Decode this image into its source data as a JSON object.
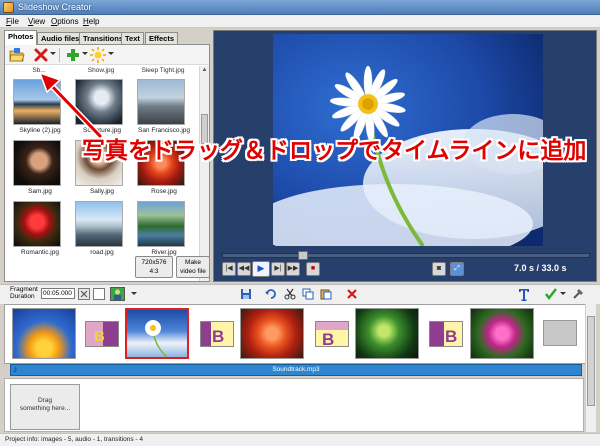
{
  "window": {
    "title": "Slideshow Creator"
  },
  "menu": [
    "File",
    "View",
    "Options",
    "Help"
  ],
  "tabs": [
    "Photos",
    "Audio files",
    "Transitions",
    "Text",
    "Effects"
  ],
  "photos": {
    "partial_row": [
      "Sb...",
      "Show.jpg",
      "Sleep Tight.jpg"
    ],
    "items": [
      {
        "label": "Skyline (2).jpg"
      },
      {
        "label": "Sculpture.jpg"
      },
      {
        "label": "San Francisco.jpg"
      },
      {
        "label": "Sam.jpg"
      },
      {
        "label": "Sally.jpg"
      },
      {
        "label": "Rose.jpg"
      },
      {
        "label": "Romantic.jpg"
      },
      {
        "label": "road.jpg"
      },
      {
        "label": "River.jpg"
      }
    ],
    "resolution_button": {
      "line1": "720x576",
      "line2": "4:3"
    },
    "make_video_button": {
      "line1": "Make",
      "line2": "video file"
    }
  },
  "preview": {
    "time": "7.0 s  / 33.0 s",
    "progress": 0.21
  },
  "callout": {
    "text": "写真をドラッグ＆ドロップでタイムラインに追加"
  },
  "timeline": {
    "fragment_label": {
      "line1": "Fragment",
      "line2": "Duration"
    },
    "fragment_duration": "00:05.000",
    "soundtrack": "Soundtrack.mp3",
    "drag_placeholder": {
      "line1": "Drag",
      "line2": "something here..."
    }
  },
  "status": "Project info: images - 5, audio - 1, transitions - 4",
  "colors": {
    "accent_red": "#e00000",
    "audio_track": "#2e86d1",
    "preview_bg": "#263f6b"
  }
}
